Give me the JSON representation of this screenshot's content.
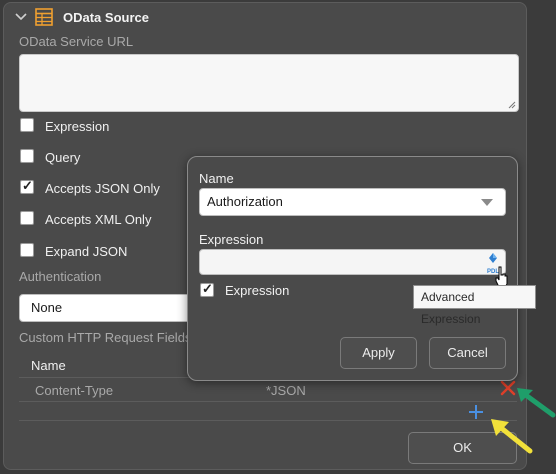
{
  "section": {
    "title": "OData Source",
    "url_label": "OData Service URL",
    "url_value": ""
  },
  "checkboxes": [
    {
      "label": "Expression",
      "checked": false
    },
    {
      "label": "Query",
      "checked": false
    },
    {
      "label": "Accepts JSON Only",
      "checked": true
    },
    {
      "label": "Accepts XML Only",
      "checked": false
    },
    {
      "label": "Expand JSON",
      "checked": false
    }
  ],
  "authentication": {
    "label": "Authentication",
    "value": "None"
  },
  "custom_fields": {
    "label": "Custom HTTP Request Fields",
    "column_name": "Name",
    "rows": [
      {
        "name": "Content-Type",
        "value": "*JSON"
      }
    ]
  },
  "ok_label": "OK",
  "dialog": {
    "name_label": "Name",
    "name_value": "Authorization",
    "expression_label": "Expression",
    "expression_value": "",
    "expression_checkbox_label": "Expression",
    "expression_checked": true,
    "apply_label": "Apply",
    "cancel_label": "Cancel",
    "pdl_badge": "PDL"
  },
  "tooltip": "Advanced Expression",
  "colors": {
    "accent_orange": "#f0a030",
    "delete_red": "#e0402a",
    "add_blue": "#4a90e2",
    "arrow_green": "#1f9e6a",
    "arrow_yellow": "#f2e13a"
  }
}
